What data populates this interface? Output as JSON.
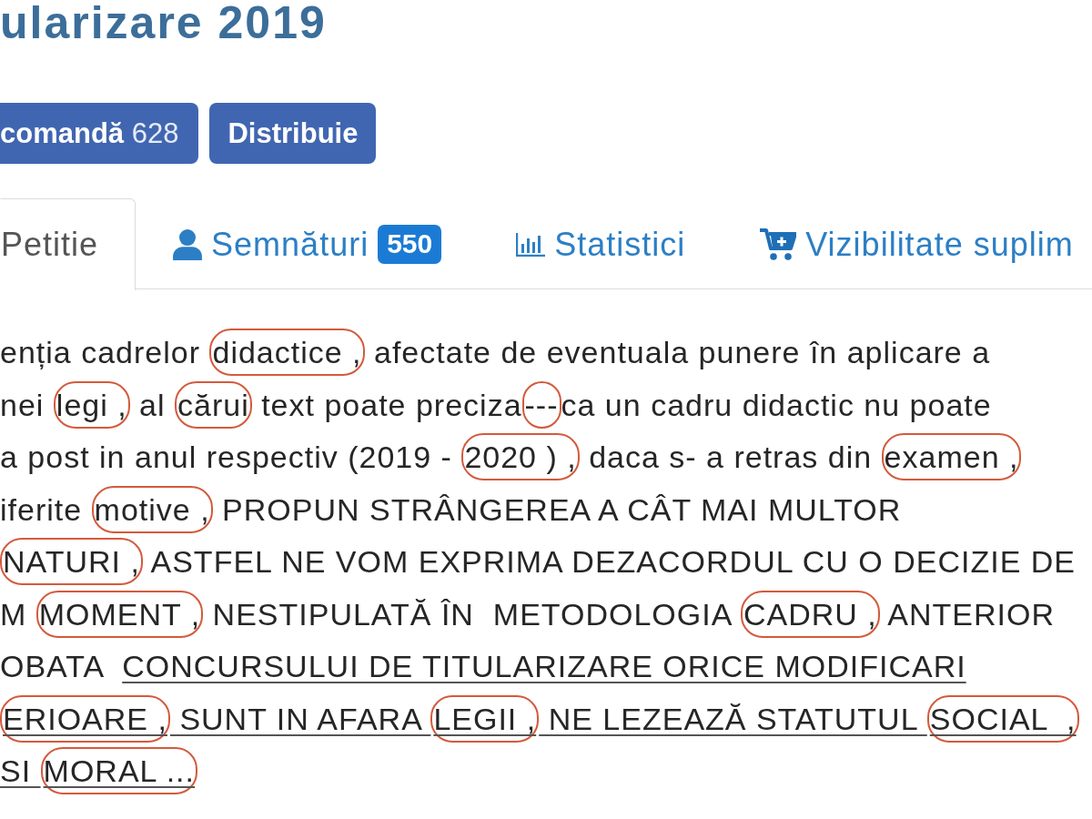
{
  "title": "ularizare 2019",
  "actions": [
    {
      "label": "comandă",
      "count": "628"
    },
    {
      "label": "Distribuie"
    }
  ],
  "tabs": [
    {
      "label": "Petitie",
      "selected": true
    },
    {
      "label": "Semnături",
      "badge": "550",
      "selected": false
    },
    {
      "label": "Statistici",
      "selected": false
    },
    {
      "label": "Vizibilitate suplim",
      "selected": false
    }
  ],
  "petition": {
    "lines": [
      {
        "segments": [
          {
            "text": "enția cadrelor ",
            "circled": false,
            "underlined": false
          },
          {
            "text": "didactice ,",
            "circled": true,
            "underlined": false
          },
          {
            "text": " afectate de eventuala punere în aplicare a",
            "circled": false,
            "underlined": false
          }
        ]
      },
      {
        "segments": [
          {
            "text": "nei ",
            "circled": false,
            "underlined": false
          },
          {
            "text": "legi ,",
            "circled": true,
            "underlined": false
          },
          {
            "text": " al ",
            "circled": false,
            "underlined": false
          },
          {
            "text": "cărui",
            "circled": true,
            "underlined": false
          },
          {
            "text": " text poate preciza",
            "circled": false,
            "underlined": false
          },
          {
            "text": "---",
            "circled": true,
            "underlined": false
          },
          {
            "text": "ca un cadru didactic nu poate",
            "circled": false,
            "underlined": false
          }
        ]
      },
      {
        "segments": [
          {
            "text": "a post in anul respectiv (2019 - ",
            "circled": false,
            "underlined": false
          },
          {
            "text": "2020 ) ,",
            "circled": true,
            "underlined": false
          },
          {
            "text": " daca s- a retras din ",
            "circled": false,
            "underlined": false
          },
          {
            "text": "examen ,",
            "circled": true,
            "underlined": false
          }
        ]
      },
      {
        "segments": [
          {
            "text": "iferite ",
            "circled": false,
            "underlined": false
          },
          {
            "text": "motive ,",
            "circled": true,
            "underlined": false
          },
          {
            "text": " PROPUN STRÂNGEREA A CÂT MAI MULTOR",
            "circled": false,
            "underlined": false
          }
        ]
      },
      {
        "segments": [
          {
            "text": "NATURI ,",
            "circled": true,
            "underlined": false
          },
          {
            "text": " ASTFEL NE VOM EXPRIMA DEZACORDUL CU O DECIZIE DE",
            "circled": false,
            "underlined": false
          }
        ]
      },
      {
        "segments": [
          {
            "text": "M ",
            "circled": false,
            "underlined": false
          },
          {
            "text": "MOMENT ,",
            "circled": true,
            "underlined": false
          },
          {
            "text": " NESTIPULATĂ ÎN  METODOLOGIA ",
            "circled": false,
            "underlined": false
          },
          {
            "text": "CADRU ,",
            "circled": true,
            "underlined": false
          },
          {
            "text": " ANTERIOR",
            "circled": false,
            "underlined": false
          }
        ]
      },
      {
        "segments": [
          {
            "text": "OBATA  ",
            "circled": false,
            "underlined": false
          },
          {
            "text": "CONCURSULUI DE TITULARIZARE ORICE MODIFICARI",
            "circled": false,
            "underlined": true
          }
        ]
      },
      {
        "segments": [
          {
            "text": "ERIOARE ,",
            "circled": true,
            "underlined": true
          },
          {
            "text": " SUNT IN AFARA ",
            "circled": false,
            "underlined": true
          },
          {
            "text": "LEGII ,",
            "circled": true,
            "underlined": true
          },
          {
            "text": " NE LEZEAZĂ STATUTUL ",
            "circled": false,
            "underlined": true
          },
          {
            "text": "SOCIAL  ,",
            "circled": true,
            "underlined": true
          }
        ]
      },
      {
        "segments": [
          {
            "text": "SI ",
            "circled": false,
            "underlined": true
          },
          {
            "text": "MORAL ...",
            "circled": true,
            "underlined": true
          }
        ]
      }
    ]
  }
}
